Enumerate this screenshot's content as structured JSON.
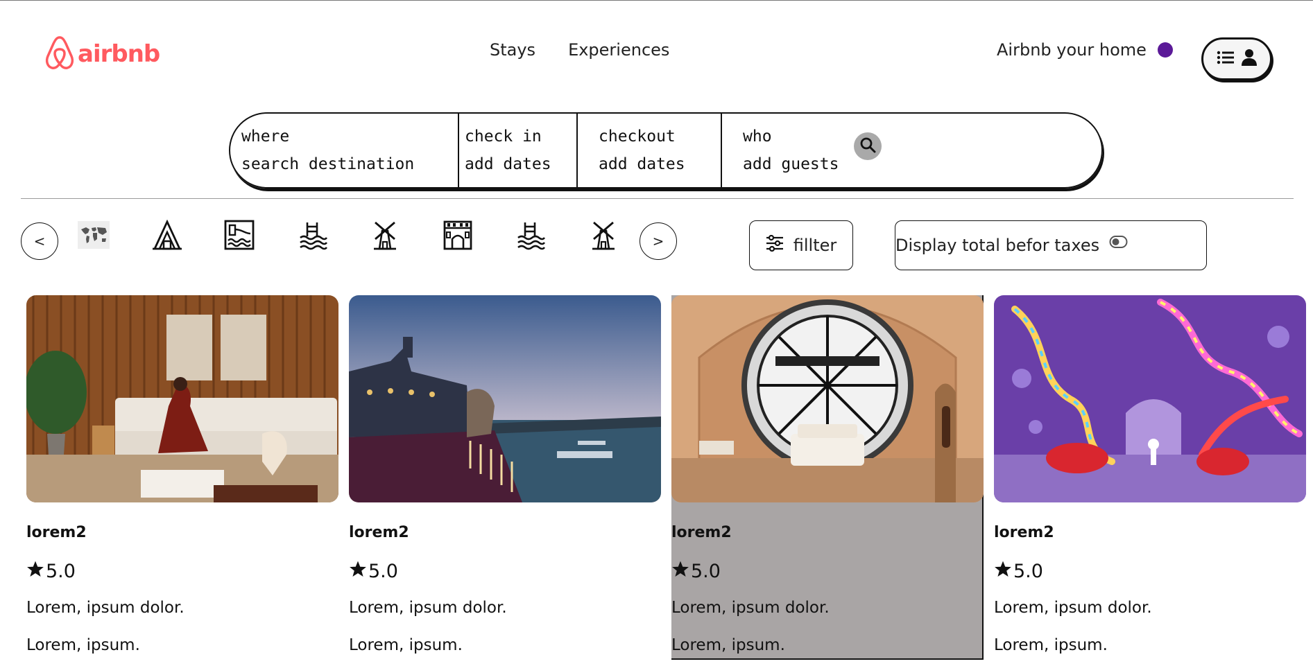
{
  "header": {
    "logo_text": "airbnb",
    "brand_color": "#ff5a5f",
    "nav": [
      {
        "label": "Stays"
      },
      {
        "label": "Experiences"
      }
    ],
    "host_label": "Airbnb your home",
    "accent_color": "#5b1a98",
    "menu_icons": [
      "list-icon",
      "user-icon"
    ]
  },
  "search": {
    "where_label": "where",
    "where_value": "search destination",
    "checkin_label": "check in",
    "checkin_value": "add dates",
    "checkout_label": "checkout",
    "checkout_value": "add dates",
    "who_label": "who",
    "who_value": "add guests",
    "button_icon": "search-icon"
  },
  "categories": {
    "prev_label": "<",
    "next_label": ">",
    "icons": [
      "world-map-icon",
      "a-frame-icon",
      "lakefront-icon",
      "beach-icon",
      "windmill-icon",
      "castle-icon",
      "beach-icon",
      "windmill-icon"
    ]
  },
  "filter": {
    "label": "fillter",
    "icon": "sliders-icon"
  },
  "taxes": {
    "label": "Display total befor taxes",
    "toggle_icon": "toggle-icon"
  },
  "listings": [
    {
      "title": "lorem2",
      "rating": "5.0",
      "line1": "Lorem, ipsum dolor.",
      "line2": "Lorem, ipsum.",
      "photo": "living-room-wood"
    },
    {
      "title": "lorem2",
      "rating": "5.0",
      "line1": "Lorem, ipsum dolor.",
      "line2": "Lorem, ipsum.",
      "photo": "paris-rooftop"
    },
    {
      "title": "lorem2",
      "rating": "5.0",
      "line1": "Lorem, ipsum dolor.",
      "line2": "Lorem, ipsum.",
      "photo": "clock-room"
    },
    {
      "title": "lorem2",
      "rating": "5.0",
      "line1": "Lorem, ipsum dolor.",
      "line2": "Lorem, ipsum.",
      "photo": "purple-neon-room"
    }
  ]
}
